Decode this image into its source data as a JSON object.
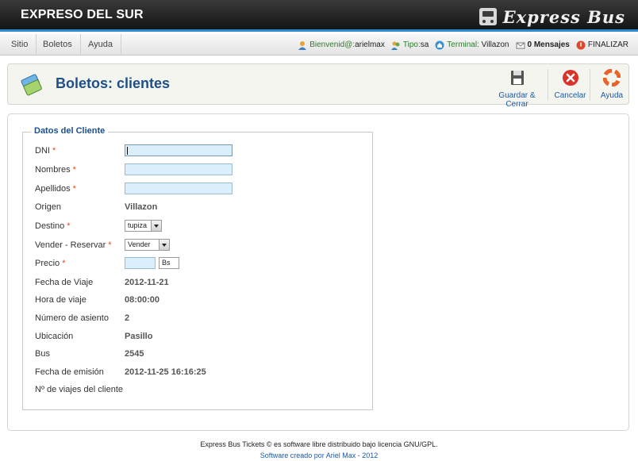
{
  "header": {
    "app_title": "EXPRESO DEL SUR",
    "brand": "Express Bus",
    "brand_icon": "bus-icon"
  },
  "menu": {
    "items": [
      "Sitio",
      "Boletos",
      "Ayuda"
    ]
  },
  "status": {
    "welcome_label": "Bienvenid@:",
    "username": "arielmax",
    "type_label": "Tipo:",
    "type_value": "sa",
    "terminal_label": "Terminal:",
    "terminal_value": "Villazon",
    "messages": "0 Mensajes",
    "logout": "FINALIZAR"
  },
  "toolbar": {
    "title": "Boletos: clientes",
    "save_label": "Guardar & Cerrar",
    "cancel_label": "Cancelar",
    "help_label": "Ayuda"
  },
  "form": {
    "legend": "Datos del Cliente",
    "required_mark": "*",
    "dni_label": "DNI",
    "dni_value": "",
    "nombres_label": "Nombres",
    "nombres_value": "",
    "apellidos_label": "Apellidos",
    "apellidos_value": "",
    "origen_label": "Origen",
    "origen_value": "Villazon",
    "destino_label": "Destino",
    "destino_selected": "tupiza",
    "vender_label": "Vender - Reservar",
    "vender_selected": "Vender",
    "precio_label": "Precio",
    "precio_value": "",
    "precio_unit": "Bs",
    "fecha_viaje_label": "Fecha de Viaje",
    "fecha_viaje_value": "2012-11-21",
    "hora_label": "Hora de viaje",
    "hora_value": "08:00:00",
    "asiento_label": "Número de asiento",
    "asiento_value": "2",
    "ubicacion_label": "Ubicación",
    "ubicacion_value": "Pasillo",
    "bus_label": "Bus",
    "bus_value": "2545",
    "emision_label": "Fecha de emisión",
    "emision_value": "2012-11-25 16:16:25",
    "viajes_label": "Nº de viajes del cliente",
    "viajes_value": ""
  },
  "footer": {
    "line1": "Express Bus Tickets © es software libre distribuido bajo licencia GNU/GPL.",
    "line2": "Software creado por Ariel Max - 2012"
  },
  "colors": {
    "accent": "#1d4f8c",
    "link": "#1b5aa6",
    "required": "#e04a1a",
    "input_bg": "#dbeefb"
  }
}
